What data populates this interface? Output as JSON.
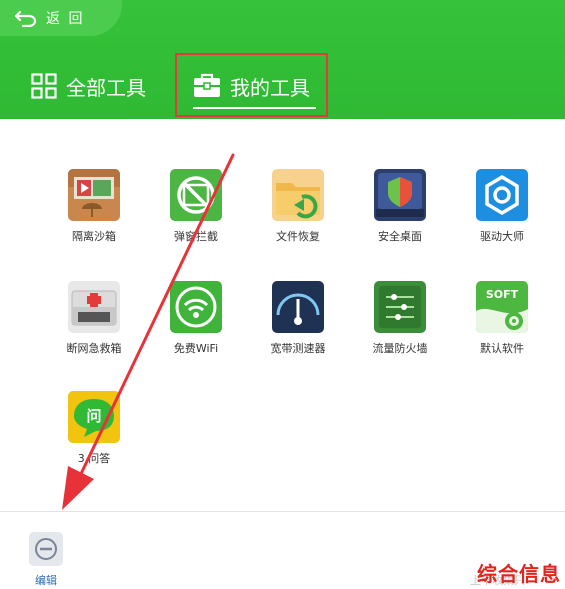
{
  "header": {
    "back_label": "返 回",
    "tabs": [
      {
        "label": "全部工具"
      },
      {
        "label": "我的工具"
      }
    ]
  },
  "tools": [
    {
      "label": "隔离沙箱"
    },
    {
      "label": "弹窗拦截"
    },
    {
      "label": "文件恢复"
    },
    {
      "label": "安全桌面"
    },
    {
      "label": "驱动大师"
    },
    {
      "label": "断网急救箱"
    },
    {
      "label": "免费WiFi"
    },
    {
      "label": "宽带测速器"
    },
    {
      "label": "流量防火墙"
    },
    {
      "label": "默认软件"
    },
    {
      "label": "3 问答",
      "icon_text": "问"
    }
  ],
  "soft_icon_text": "SOFT",
  "footer": {
    "edit_label": "编辑",
    "faint_text": "上不收集只",
    "watermark": "综合信息"
  },
  "colors": {
    "header_green": "#2fb934",
    "highlight_red": "#e43a3a",
    "arrow_red": "#e8323a",
    "link_blue": "#2a6fb8"
  }
}
